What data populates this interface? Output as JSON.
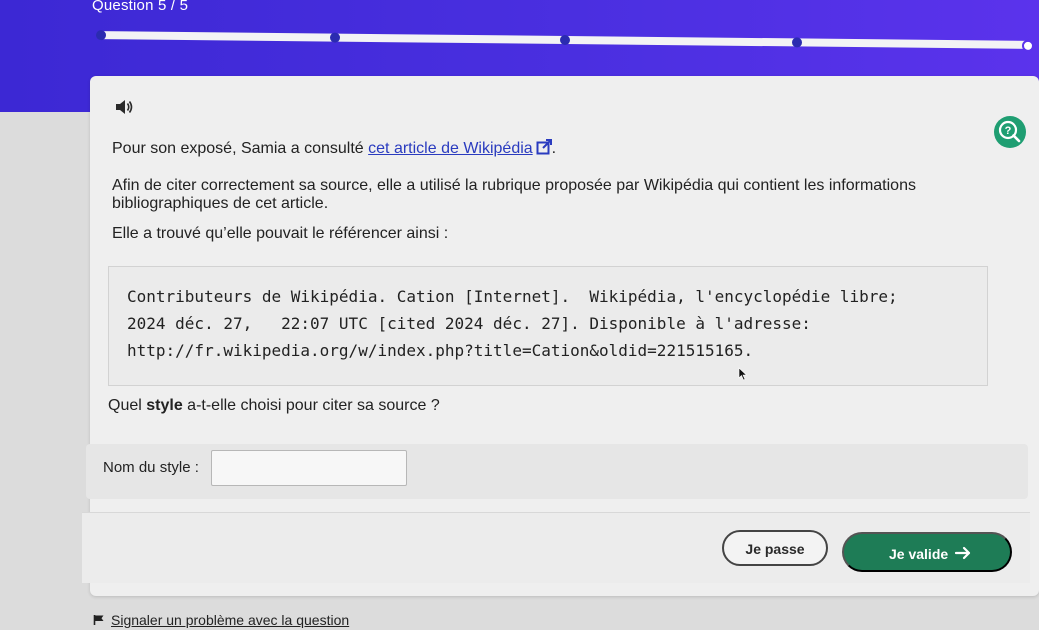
{
  "header": {
    "question_counter": "Question 5 / 5",
    "progress": {
      "total_steps": 5,
      "current_step": 5
    }
  },
  "colors": {
    "header_bg": "#4a2fe0",
    "primary_green": "#1e7c56",
    "help_green": "#1f9e72",
    "link_blue": "#2a3bbf"
  },
  "icons": {
    "audio": "speaker-icon",
    "help": "help-icon",
    "external": "external-link-icon",
    "report": "flag-icon",
    "validate_arrow": "arrow-right-icon"
  },
  "question": {
    "p1_before_link": "Pour son exposé, Samia a consulté ",
    "p1_link": "cet article de Wikipédia",
    "p1_after_link": ".",
    "p2": "Afin de citer correctement sa source, elle a utilisé la rubrique proposée par Wikipédia qui contient les informations bibliographiques de cet article.",
    "p3": "Elle a trouvé qu’elle pouvait le référencer ainsi :",
    "citation_lines": [
      "Contributeurs de Wikipédia. Cation [Internet].  Wikipédia, l'encyclopédie libre;",
      "2024 déc. 27,   22:07 UTC [cited 2024 déc. 27]. Disponible à l'adresse:",
      "http://fr.wikipedia.org/w/index.php?title=Cation&oldid=221515165."
    ],
    "ask_before": "Quel ",
    "ask_bold": "style",
    "ask_after": " a-t-elle choisi pour citer sa source ?"
  },
  "answer": {
    "label": "Nom du style :",
    "value": "",
    "placeholder": ""
  },
  "actions": {
    "skip_label": "Je passe",
    "validate_label": "Je valide"
  },
  "footer": {
    "report_label": "Signaler un problème avec la question"
  }
}
